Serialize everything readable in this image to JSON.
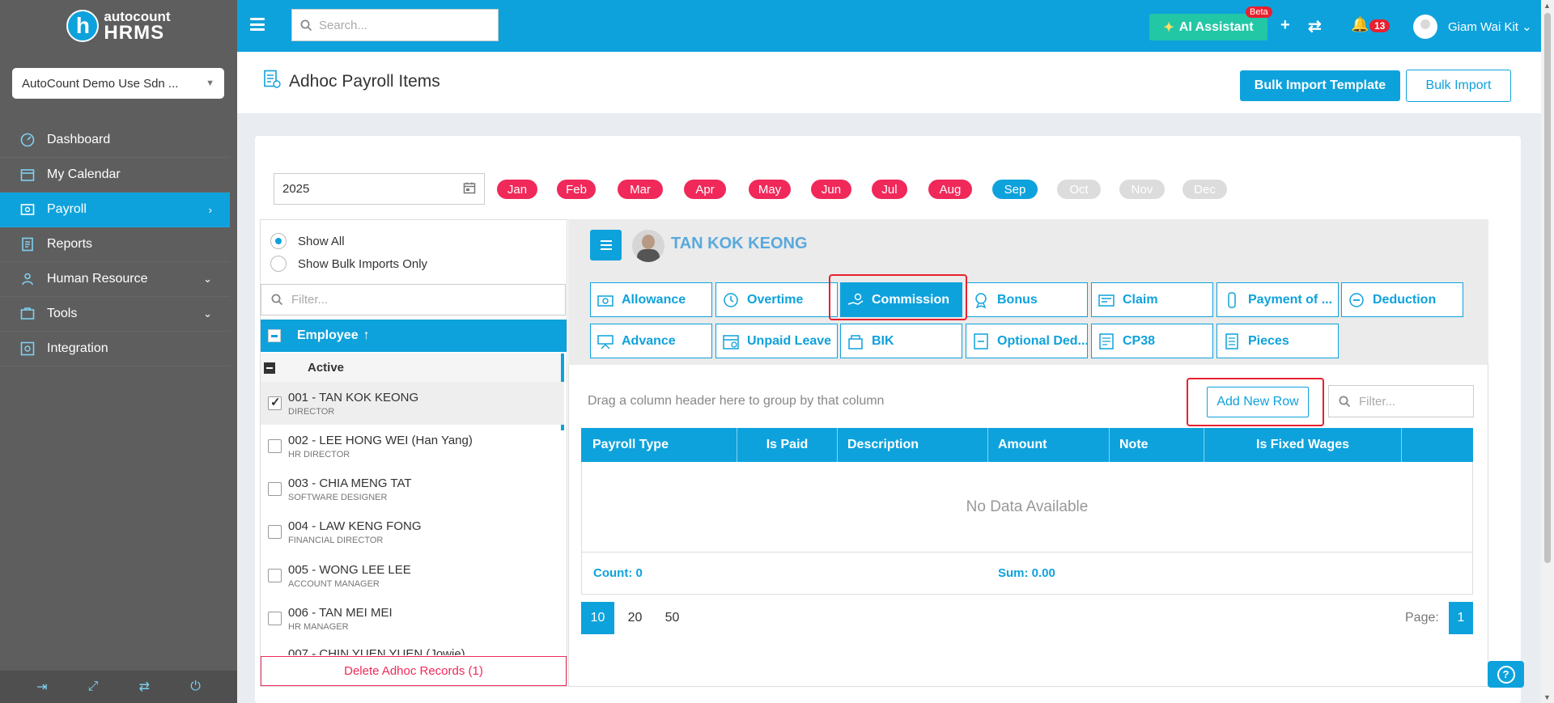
{
  "brand": {
    "line1": "autocount",
    "line2": "HRMS",
    "mark": "h"
  },
  "company": {
    "selected": "AutoCount Demo Use Sdn ..."
  },
  "sidebar": {
    "items": [
      {
        "label": "Dashboard",
        "icon": "dashboard-icon"
      },
      {
        "label": "My Calendar",
        "icon": "calendar-icon"
      },
      {
        "label": "Payroll",
        "icon": "payroll-icon",
        "active": true
      },
      {
        "label": "Reports",
        "icon": "reports-icon"
      },
      {
        "label": "Human Resource",
        "icon": "human-resource-icon"
      },
      {
        "label": "Tools",
        "icon": "tools-icon"
      },
      {
        "label": "Integration",
        "icon": "integration-icon"
      }
    ]
  },
  "topbar": {
    "search_placeholder": "Search...",
    "ai_label": "AI Assistant",
    "beta": "Beta",
    "notif_count": "13",
    "user_name": "Giam Wai Kit"
  },
  "page": {
    "title": "Adhoc Payroll Items",
    "bulk_import_template": "Bulk Import Template",
    "bulk_import": "Bulk Import"
  },
  "filters": {
    "year": "2025",
    "months": [
      "Jan",
      "Feb",
      "Mar",
      "Apr",
      "May",
      "Jun",
      "Jul",
      "Aug",
      "Sep",
      "Oct",
      "Nov",
      "Dec"
    ],
    "selected_month": "Sep"
  },
  "employees": {
    "show_all": "Show All",
    "show_bulk": "Show Bulk Imports Only",
    "filter_placeholder": "Filter...",
    "header": "Employee",
    "group": "Active",
    "rows": [
      {
        "name": "001 - TAN KOK KEONG",
        "role": "DIRECTOR",
        "checked": true
      },
      {
        "name": "002 - LEE HONG WEI (Han Yang)",
        "role": "HR DIRECTOR",
        "checked": false
      },
      {
        "name": "003 - CHIA MENG TAT",
        "role": "SOFTWARE DESIGNER",
        "checked": false
      },
      {
        "name": "004 - LAW KENG FONG",
        "role": "FINANCIAL DIRECTOR",
        "checked": false
      },
      {
        "name": "005 - WONG LEE LEE",
        "role": "ACCOUNT MANAGER",
        "checked": false
      },
      {
        "name": "006 - TAN MEI MEI",
        "role": "HR MANAGER",
        "checked": false
      },
      {
        "name": "007 - CHIN YUEN YUEN (Jowie)",
        "role": "",
        "checked": false
      }
    ],
    "delete_label": "Delete Adhoc Records (1)"
  },
  "detail": {
    "employee_name": "TAN KOK KEONG",
    "types": [
      {
        "label": "Allowance",
        "icon": "allowance-icon"
      },
      {
        "label": "Overtime",
        "icon": "overtime-icon"
      },
      {
        "label": "Commission",
        "icon": "commission-icon",
        "active": true
      },
      {
        "label": "Bonus",
        "icon": "bonus-icon"
      },
      {
        "label": "Claim",
        "icon": "claim-icon"
      },
      {
        "label": "Payment of ...",
        "icon": "payment-icon"
      },
      {
        "label": "Deduction",
        "icon": "deduction-icon"
      },
      {
        "label": "Advance",
        "icon": "advance-icon"
      },
      {
        "label": "Unpaid Leave",
        "icon": "unpaid-leave-icon"
      },
      {
        "label": "BIK",
        "icon": "bik-icon"
      },
      {
        "label": "Optional Ded...",
        "icon": "optional-deduction-icon"
      },
      {
        "label": "CP38",
        "icon": "cp38-icon"
      },
      {
        "label": "Pieces",
        "icon": "pieces-icon"
      }
    ],
    "group_hint": "Drag a column header here to group by that column",
    "add_row": "Add New Row",
    "grid_filter_placeholder": "Filter...",
    "columns": [
      "Payroll Type",
      "Is Paid",
      "Description",
      "Amount",
      "Note",
      "Is Fixed Wages"
    ],
    "empty": "No Data Available",
    "count": "Count: 0",
    "sum": "Sum: 0.00",
    "page_sizes": [
      "10",
      "20",
      "50"
    ],
    "page_label": "Page:",
    "current_page": "1"
  },
  "colors": {
    "primary": "#0ea2dc",
    "month_active": "#f0295a",
    "month_inactive": "#dcdcdc",
    "highlight": "#e8202f"
  }
}
